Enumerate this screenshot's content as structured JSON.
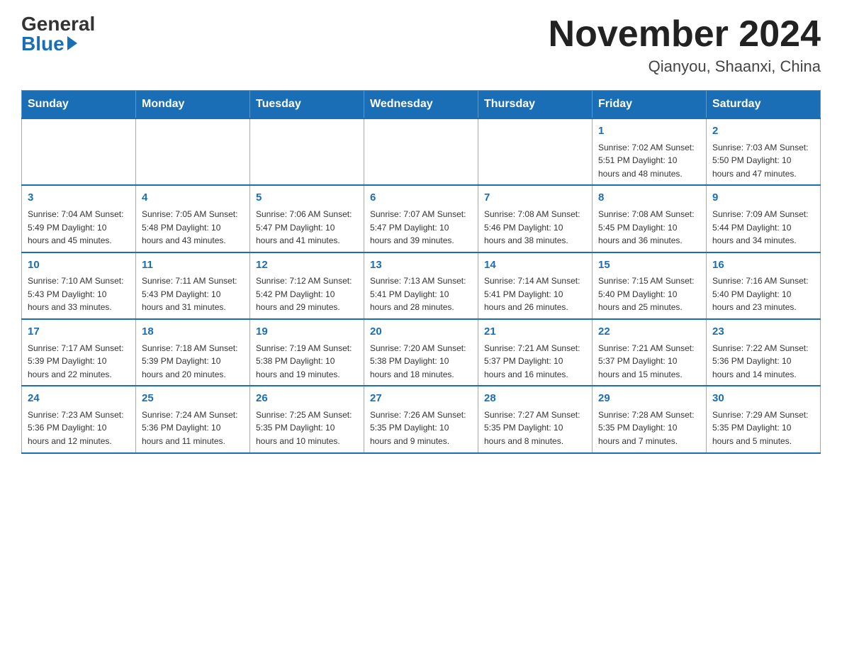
{
  "header": {
    "logo_general": "General",
    "logo_blue": "Blue",
    "month_title": "November 2024",
    "location": "Qianyou, Shaanxi, China"
  },
  "weekdays": [
    "Sunday",
    "Monday",
    "Tuesday",
    "Wednesday",
    "Thursday",
    "Friday",
    "Saturday"
  ],
  "weeks": [
    [
      {
        "day": "",
        "info": ""
      },
      {
        "day": "",
        "info": ""
      },
      {
        "day": "",
        "info": ""
      },
      {
        "day": "",
        "info": ""
      },
      {
        "day": "",
        "info": ""
      },
      {
        "day": "1",
        "info": "Sunrise: 7:02 AM\nSunset: 5:51 PM\nDaylight: 10 hours and 48 minutes."
      },
      {
        "day": "2",
        "info": "Sunrise: 7:03 AM\nSunset: 5:50 PM\nDaylight: 10 hours and 47 minutes."
      }
    ],
    [
      {
        "day": "3",
        "info": "Sunrise: 7:04 AM\nSunset: 5:49 PM\nDaylight: 10 hours and 45 minutes."
      },
      {
        "day": "4",
        "info": "Sunrise: 7:05 AM\nSunset: 5:48 PM\nDaylight: 10 hours and 43 minutes."
      },
      {
        "day": "5",
        "info": "Sunrise: 7:06 AM\nSunset: 5:47 PM\nDaylight: 10 hours and 41 minutes."
      },
      {
        "day": "6",
        "info": "Sunrise: 7:07 AM\nSunset: 5:47 PM\nDaylight: 10 hours and 39 minutes."
      },
      {
        "day": "7",
        "info": "Sunrise: 7:08 AM\nSunset: 5:46 PM\nDaylight: 10 hours and 38 minutes."
      },
      {
        "day": "8",
        "info": "Sunrise: 7:08 AM\nSunset: 5:45 PM\nDaylight: 10 hours and 36 minutes."
      },
      {
        "day": "9",
        "info": "Sunrise: 7:09 AM\nSunset: 5:44 PM\nDaylight: 10 hours and 34 minutes."
      }
    ],
    [
      {
        "day": "10",
        "info": "Sunrise: 7:10 AM\nSunset: 5:43 PM\nDaylight: 10 hours and 33 minutes."
      },
      {
        "day": "11",
        "info": "Sunrise: 7:11 AM\nSunset: 5:43 PM\nDaylight: 10 hours and 31 minutes."
      },
      {
        "day": "12",
        "info": "Sunrise: 7:12 AM\nSunset: 5:42 PM\nDaylight: 10 hours and 29 minutes."
      },
      {
        "day": "13",
        "info": "Sunrise: 7:13 AM\nSunset: 5:41 PM\nDaylight: 10 hours and 28 minutes."
      },
      {
        "day": "14",
        "info": "Sunrise: 7:14 AM\nSunset: 5:41 PM\nDaylight: 10 hours and 26 minutes."
      },
      {
        "day": "15",
        "info": "Sunrise: 7:15 AM\nSunset: 5:40 PM\nDaylight: 10 hours and 25 minutes."
      },
      {
        "day": "16",
        "info": "Sunrise: 7:16 AM\nSunset: 5:40 PM\nDaylight: 10 hours and 23 minutes."
      }
    ],
    [
      {
        "day": "17",
        "info": "Sunrise: 7:17 AM\nSunset: 5:39 PM\nDaylight: 10 hours and 22 minutes."
      },
      {
        "day": "18",
        "info": "Sunrise: 7:18 AM\nSunset: 5:39 PM\nDaylight: 10 hours and 20 minutes."
      },
      {
        "day": "19",
        "info": "Sunrise: 7:19 AM\nSunset: 5:38 PM\nDaylight: 10 hours and 19 minutes."
      },
      {
        "day": "20",
        "info": "Sunrise: 7:20 AM\nSunset: 5:38 PM\nDaylight: 10 hours and 18 minutes."
      },
      {
        "day": "21",
        "info": "Sunrise: 7:21 AM\nSunset: 5:37 PM\nDaylight: 10 hours and 16 minutes."
      },
      {
        "day": "22",
        "info": "Sunrise: 7:21 AM\nSunset: 5:37 PM\nDaylight: 10 hours and 15 minutes."
      },
      {
        "day": "23",
        "info": "Sunrise: 7:22 AM\nSunset: 5:36 PM\nDaylight: 10 hours and 14 minutes."
      }
    ],
    [
      {
        "day": "24",
        "info": "Sunrise: 7:23 AM\nSunset: 5:36 PM\nDaylight: 10 hours and 12 minutes."
      },
      {
        "day": "25",
        "info": "Sunrise: 7:24 AM\nSunset: 5:36 PM\nDaylight: 10 hours and 11 minutes."
      },
      {
        "day": "26",
        "info": "Sunrise: 7:25 AM\nSunset: 5:35 PM\nDaylight: 10 hours and 10 minutes."
      },
      {
        "day": "27",
        "info": "Sunrise: 7:26 AM\nSunset: 5:35 PM\nDaylight: 10 hours and 9 minutes."
      },
      {
        "day": "28",
        "info": "Sunrise: 7:27 AM\nSunset: 5:35 PM\nDaylight: 10 hours and 8 minutes."
      },
      {
        "day": "29",
        "info": "Sunrise: 7:28 AM\nSunset: 5:35 PM\nDaylight: 10 hours and 7 minutes."
      },
      {
        "day": "30",
        "info": "Sunrise: 7:29 AM\nSunset: 5:35 PM\nDaylight: 10 hours and 5 minutes."
      }
    ]
  ]
}
